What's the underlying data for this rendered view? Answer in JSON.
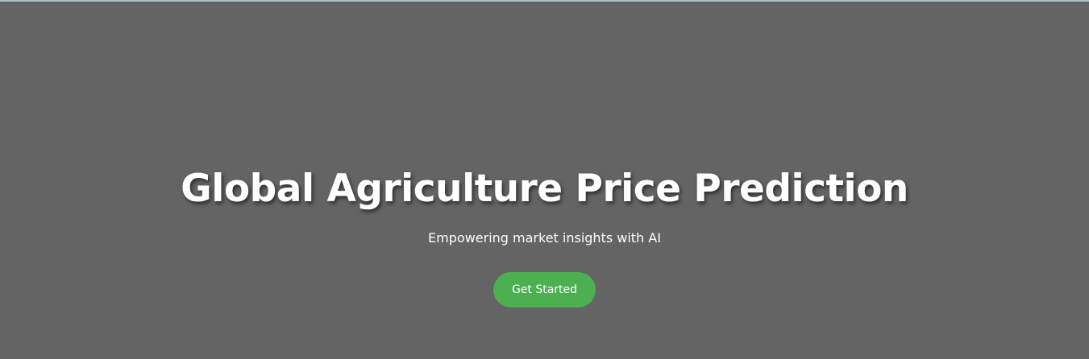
{
  "hero": {
    "title": "Global Agriculture Price Prediction",
    "subtitle": "Empowering market insights with AI",
    "cta_label": "Get Started"
  },
  "colors": {
    "background": "#636463",
    "accent": "#4caf50",
    "text": "#ffffff"
  }
}
